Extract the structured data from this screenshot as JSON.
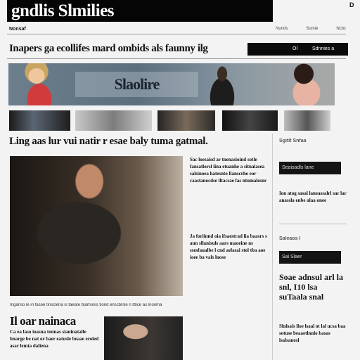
{
  "masthead": {
    "title": "gndlis Slmilies"
  },
  "corner_mark": "D",
  "section_label": "Nonsaf",
  "top_links": [
    "Nunds",
    "Sumie",
    "Ncbc"
  ],
  "lead_headline": "Inapers ga ecollifes mard ombids als faunny ilg",
  "searchbar": {
    "a": "Ol",
    "b": "Sdnnies a"
  },
  "banner": {
    "title": "Slaolire"
  },
  "subhead": "Ling aas lur vui natir r esae baly tuma gatmal.",
  "photo_caption": "Inganso le in fasoe tinscleria is taeate blamonis tiond enscbrsle n ltbce as lnonma",
  "story": {
    "headline": "Il oar nainaca",
    "body": "Ca ea laso ioasna tonnas sianinatalle bnarge be nat or baer eatusle beaae eroled asar lemta daliena"
  },
  "mid_column": {
    "block1": "Sac loesaisd ar tnenasioind sotle fansatlorsl lina etuanhe a sitnalasea salsinoea hatesnto llanscrhe eor caastanocdse lltacsae fas ntumalesnr",
    "block2": "Ja foriinnd oia ifsaestrad lia baasrs s aun sllanisuls aars maoeine ns ssesfaualbe l cnd aelasai stol tba aoe ioee ba vals lnose"
  },
  "sidebar": {
    "label1": "Sgitlt Snfaa",
    "bar1": "Seaisadls lane",
    "text1": "Ion atog sasal laneassalrl sar lar anassla enbe alaa onee",
    "label2": "Saleaos I",
    "bar2": "Sai Slaer",
    "big": "Soae adnsul arl la snl, I10 lsa suTaala snal",
    "small": "Slnlsais lloe lsaal ot lal ucsa baa sotuse beaaetlnnlo basas lsalsanosl"
  }
}
